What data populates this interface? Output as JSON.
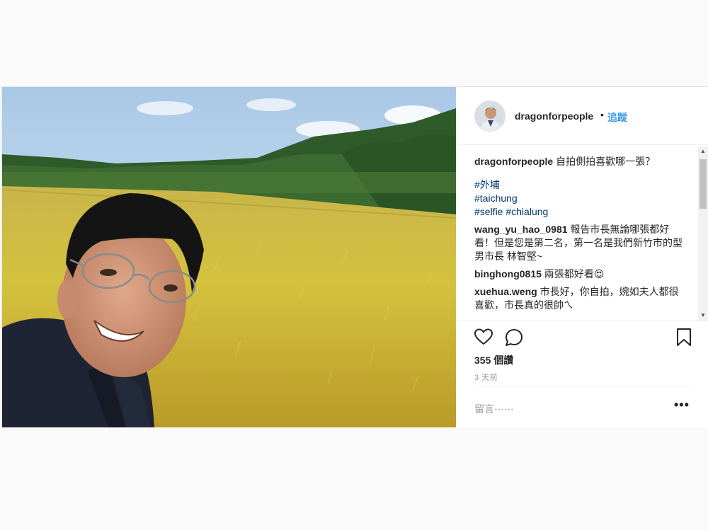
{
  "header": {
    "username": "dragonforpeople",
    "separator": "•",
    "follow_label": "追蹤"
  },
  "caption": {
    "username": "dragonforpeople",
    "text": "自拍側拍喜歡哪一張？",
    "tags": [
      "#外埔",
      "#taichung",
      "#selfie #chialung"
    ]
  },
  "comments": [
    {
      "username": "wang_yu_hao_0981",
      "text": "報告市長無論哪張都好看！但是您是第二名，第一名是我們新竹市的型男市長 林智堅~"
    },
    {
      "username": "binghong0815",
      "text": "兩張都好看😍"
    },
    {
      "username": "xuehua.weng",
      "text": "市長好，你自拍，婉如夫人都很喜歡，市長真的很帥ㄟ"
    }
  ],
  "stats": {
    "views": "355 個讚",
    "time": "3 天前"
  },
  "add_comment": {
    "placeholder": "留言⋯⋯",
    "more_label": "•••"
  },
  "icons": {
    "like": "heart-icon",
    "comment": "comment-icon",
    "save": "bookmark-icon",
    "more": "more-options-icon"
  },
  "colors": {
    "follow": "#3897f0",
    "text": "#262626",
    "muted": "#999999"
  }
}
